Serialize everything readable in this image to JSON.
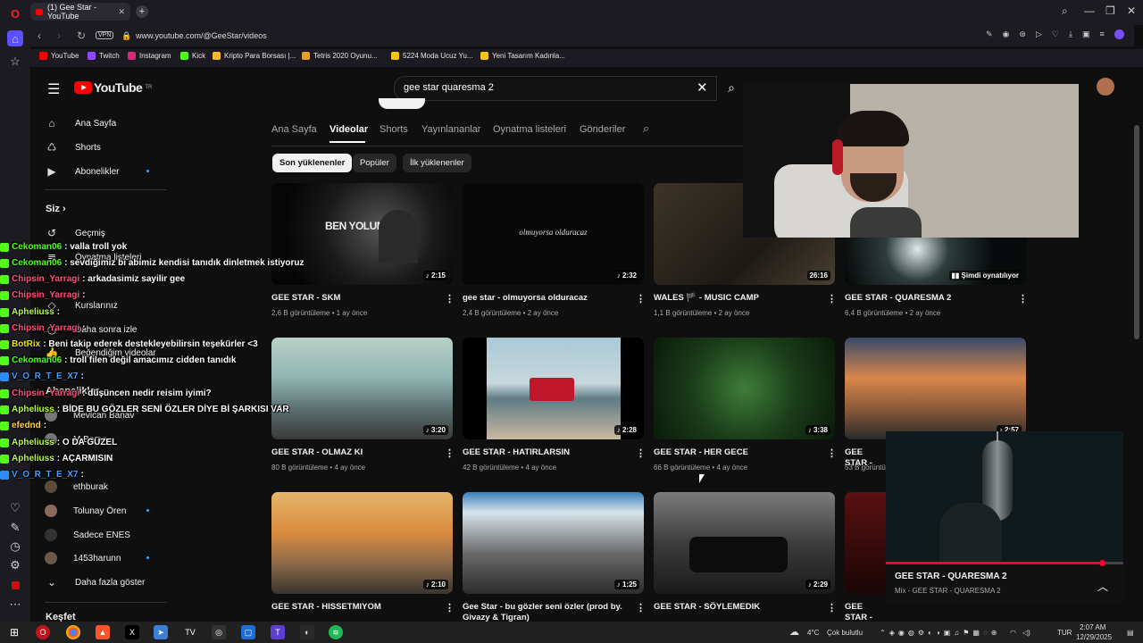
{
  "browser": {
    "tab_title": "(1) Gee Star - YouTube",
    "url": "www.youtube.com/@GeeStar/videos",
    "vpn_label": "VPN",
    "new_tab": "+",
    "bookmarks": [
      {
        "label": "YouTube",
        "color": "#ff0000"
      },
      {
        "label": "Twitch",
        "color": "#9146ff"
      },
      {
        "label": "Instagram",
        "color": "#d62976"
      },
      {
        "label": "Kick",
        "color": "#53fc18"
      },
      {
        "label": "Kripto Para Borsası |...",
        "color": "#f3ba2f"
      },
      {
        "label": "Tetris 2020 Oyunu...",
        "color": "#e0a030"
      },
      {
        "label": "5224 Moda Ucuz Yu...",
        "color": "#f5c518"
      },
      {
        "label": "Yeni Tasarım Kadınla...",
        "color": "#f5c518"
      }
    ]
  },
  "youtube": {
    "logo": "YouTube",
    "logo_region": "TR",
    "search_query": "gee star quaresma 2",
    "sidebar": {
      "main": [
        {
          "label": "Ana Sayfa",
          "icon": "home-icon"
        },
        {
          "label": "Shorts",
          "icon": "shorts-icon"
        },
        {
          "label": "Abonelikler",
          "icon": "subscriptions-icon"
        }
      ],
      "you_heading": "Siz",
      "you_items": [
        "Geçmiş",
        "Oynatma listeleri",
        "Kurslarınız",
        "Daha sonra izle",
        "Beğendiğim videolar"
      ],
      "subs_heading": "Abonelikler",
      "subs": [
        "Mevlcan Banav",
        "M Boran",
        "ethburak",
        "Tolunay Ören",
        "Sadece ENES",
        "1453harunn"
      ],
      "show_more": "Daha fazla göster",
      "explore_heading": "Keşfet"
    },
    "channel_tabs": [
      "Ana Sayfa",
      "Videolar",
      "Shorts",
      "Yayınlananlar",
      "Oynatma listeleri",
      "Gönderiler"
    ],
    "active_tab": "Videolar",
    "chips": [
      "Son yüklenenler",
      "Popüler",
      "İlk yüklenenler"
    ],
    "videos": [
      {
        "title": "GEE STAR - SKM",
        "views": "2,6 B görüntüleme",
        "age": "1 ay önce",
        "duration": "2:15",
        "thumb_text": "BEN YOLUMDAN"
      },
      {
        "title": "gee star - olmuyorsa olduracaz",
        "views": "2,4 B görüntüleme",
        "age": "2 ay önce",
        "duration": "2:32",
        "thumb_text": "olmuyorsa olduracaz"
      },
      {
        "title": "WALES 🏴 - MUSIC CAMP",
        "views": "1,1 B görüntüleme",
        "age": "2 ay önce",
        "duration": "26:16",
        "thumb_text": ""
      },
      {
        "title": "GEE STAR - QUARESMA 2",
        "views": "6,4 B görüntüleme",
        "age": "2 ay önce",
        "duration": "Şimdi oynatılıyor",
        "thumb_text": ""
      },
      {
        "title": "GEE STAR - OLMAZ KI",
        "views": "80 B görüntüleme",
        "age": "4 ay önce",
        "duration": "3:20",
        "thumb_text": ""
      },
      {
        "title": "GEE STAR - HATIRLARSIN",
        "views": "42 B görüntüleme",
        "age": "4 ay önce",
        "duration": "2:28",
        "thumb_text": ""
      },
      {
        "title": "GEE STAR - HER GECE",
        "views": "66 B görüntüleme",
        "age": "4 ay önce",
        "duration": "3:38",
        "thumb_text": ""
      },
      {
        "title": "GEE STAR -",
        "views": "53 B görüntüleme",
        "age": "",
        "duration": "2:57",
        "thumb_text": ""
      },
      {
        "title": "GEE STAR - HISSETMIYOM",
        "views": "",
        "age": "",
        "duration": "2:10",
        "thumb_text": ""
      },
      {
        "title": "Gee Star - bu gözler seni özler (prod by. Givazy & Tigran)",
        "views": "",
        "age": "",
        "duration": "1:25",
        "thumb_text": ""
      },
      {
        "title": "GEE STAR - SÖYLEMEDIK",
        "views": "",
        "age": "",
        "duration": "2:29",
        "thumb_text": ""
      },
      {
        "title": "GEE STAR -",
        "views": "",
        "age": "",
        "duration": "",
        "thumb_text": ""
      }
    ],
    "miniplayer": {
      "title": "GEE STAR - QUARESMA 2",
      "subtitle": "Mix - GEE STAR - QUARESMA 2",
      "progress": 0.91
    }
  },
  "chat": [
    {
      "user": "Cekoman06",
      "color": "#53fc18",
      "platform": "kick",
      "text": ": valla troll yok"
    },
    {
      "user": "Cekoman06",
      "color": "#53fc18",
      "platform": "kick",
      "text": ": sevdiğimiz bi abimiz kendisi tanıdık dinletmek istiyoruz"
    },
    {
      "user": "Chipsin_Yarragi",
      "color": "#ff4f7b",
      "platform": "kick",
      "text": ": arkadasimiz sayilir gee"
    },
    {
      "user": "Chipsin_Yarragi",
      "color": "#ff4f7b",
      "platform": "kick",
      "text": ":"
    },
    {
      "user": "Apheliuss",
      "color": "#b5ff3a",
      "platform": "kick",
      "text": ":"
    },
    {
      "user": "Chipsin_Yarragi",
      "color": "#ff4f7b",
      "platform": "kick",
      "text": ":"
    },
    {
      "user": "BotRix",
      "color": "#e6e600",
      "platform": "kick",
      "text": ": Beni takip ederek destekleyebilirsin teşekürler <3"
    },
    {
      "user": "Cekoman06",
      "color": "#53fc18",
      "platform": "kick",
      "text": ": troll filen değil amacımız cidden tanıdık"
    },
    {
      "user": "V_O_R_T_E_X7",
      "color": "#3aa0ff",
      "platform": "twitch",
      "text": ":"
    },
    {
      "user": "Chipsin_Yarragi",
      "color": "#ff4f7b",
      "platform": "kick",
      "text": ": düşüncen nedir reisim iyimi?"
    },
    {
      "user": "Apheliuss",
      "color": "#b5ff3a",
      "platform": "kick",
      "text": ": BİDE BU GÖZLER SENİ ÖZLER DİYE Bİ ŞARKISI VAR"
    },
    {
      "user": "efednd",
      "color": "#ffd24a",
      "platform": "kick",
      "text": ":"
    },
    {
      "user": "Apheliuss",
      "color": "#b5ff3a",
      "platform": "kick",
      "text": ": O DA GÜZEL"
    },
    {
      "user": "Apheliuss",
      "color": "#b5ff3a",
      "platform": "kick",
      "text": ": AÇARMISIN"
    },
    {
      "user": "V_O_R_T_E_X7",
      "color": "#3aa0ff",
      "platform": "twitch",
      "text": ":"
    }
  ],
  "taskbar": {
    "weather": "4°C",
    "weather_text": "Çok bulutlu",
    "lang": "TUR",
    "time": "2:07 AM",
    "date": "12/29/2025"
  }
}
